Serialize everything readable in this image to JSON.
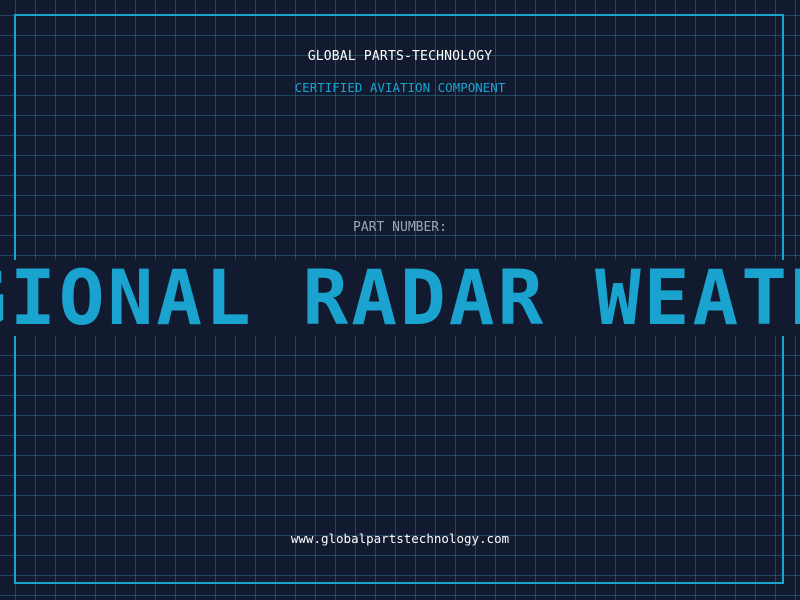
{
  "header": {
    "company": "GLOBAL PARTS-TECHNOLOGY",
    "tagline": "CERTIFIED AVIATION COMPONENT"
  },
  "part": {
    "label": "PART NUMBER:",
    "value": "REGIONAL RADAR WEATHER"
  },
  "footer": {
    "url": "www.globalpartstechnology.com"
  },
  "colors": {
    "background": "#111a2e",
    "accent": "#1aa3cf",
    "grid": "#2a6e8c",
    "text": "#ffffff",
    "muted": "#9aa7b8"
  }
}
